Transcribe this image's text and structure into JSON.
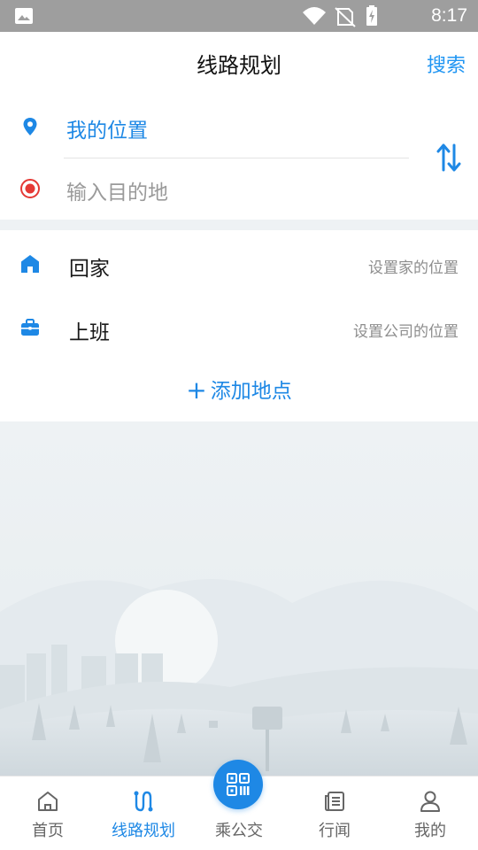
{
  "status_bar": {
    "time": "8:17"
  },
  "header": {
    "title": "线路规划",
    "search_label": "搜索"
  },
  "route": {
    "from_label": "我的位置",
    "to_placeholder": "输入目的地"
  },
  "places": {
    "home": {
      "name": "回家",
      "hint": "设置家的位置"
    },
    "work": {
      "name": "上班",
      "hint": "设置公司的位置"
    },
    "add_label": "添加地点"
  },
  "tabs": [
    {
      "label": "首页",
      "icon": "home-outline-icon"
    },
    {
      "label": "线路规划",
      "icon": "route-icon",
      "active": true
    },
    {
      "label": "乘公交",
      "icon": "qr-code-icon"
    },
    {
      "label": "行闻",
      "icon": "news-icon"
    },
    {
      "label": "我的",
      "icon": "user-icon"
    }
  ],
  "colors": {
    "accent": "#1e88e5",
    "search": "#2196f3",
    "destination": "#e53935",
    "status_bar": "#9e9e9e"
  }
}
